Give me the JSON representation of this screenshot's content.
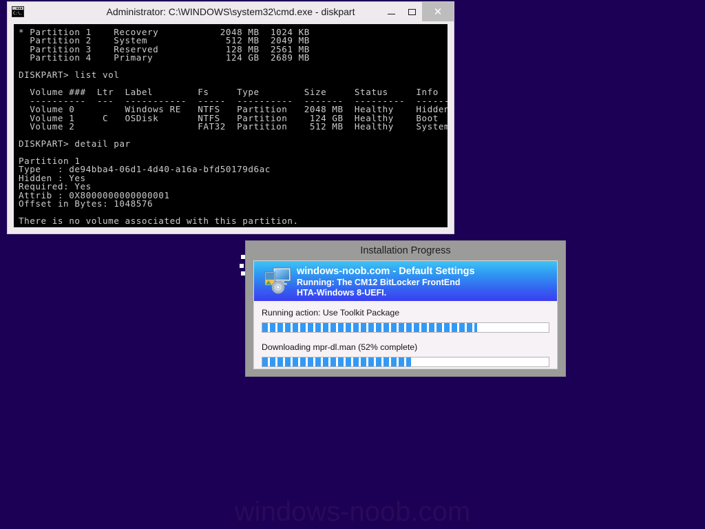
{
  "desktop": {
    "background_color": "#1b0055",
    "watermark": "windows-noob.com"
  },
  "console_window": {
    "title": "Administrator: C:\\WINDOWS\\system32\\cmd.exe - diskpart",
    "icon_name": "cmd-icon",
    "icon_text": "C:\\.",
    "buttons": {
      "minimize_label": "–",
      "maximize_label": "□",
      "close_label": "✕"
    },
    "text": "* Partition 1    Recovery           2048 MB  1024 KB\n  Partition 2    System              512 MB  2049 MB\n  Partition 3    Reserved            128 MB  2561 MB\n  Partition 4    Primary             124 GB  2689 MB\n\nDISKPART> list vol\n\n  Volume ###  Ltr  Label        Fs     Type        Size     Status     Info\n  ----------  ---  -----------  -----  ----------  -------  ---------  --------\n  Volume 0         Windows RE   NTFS   Partition   2048 MB  Healthy    Hidden\n  Volume 1     C   OSDisk       NTFS   Partition    124 GB  Healthy    Boot\n  Volume 2                      FAT32  Partition    512 MB  Healthy    System\n\nDISKPART> detail par\n\nPartition 1\nType   : de94bba4-06d1-4d40-a16a-bfd50179d6ac\nHidden : Yes\nRequired: Yes\nAttrib : 0X8000000000000001\nOffset in Bytes: 1048576\n\nThere is no volume associated with this partition.\n\nDISKPART>"
  },
  "progress_dialog": {
    "title": "Installation Progress",
    "banner": {
      "icon_name": "computer-cd-icon",
      "title": "windows-noob.com - Default Settings",
      "subtitle_line1": "Running: The CM12 BitLocker FrontEnd",
      "subtitle_line2": "HTA-Windows 8-UEFI."
    },
    "progress": [
      {
        "label": "Running action: Use Toolkit Package",
        "percent": 75
      },
      {
        "label": "Downloading mpr-dl.man (52% complete)",
        "percent": 52
      }
    ],
    "accent_color": "#3399f5"
  }
}
